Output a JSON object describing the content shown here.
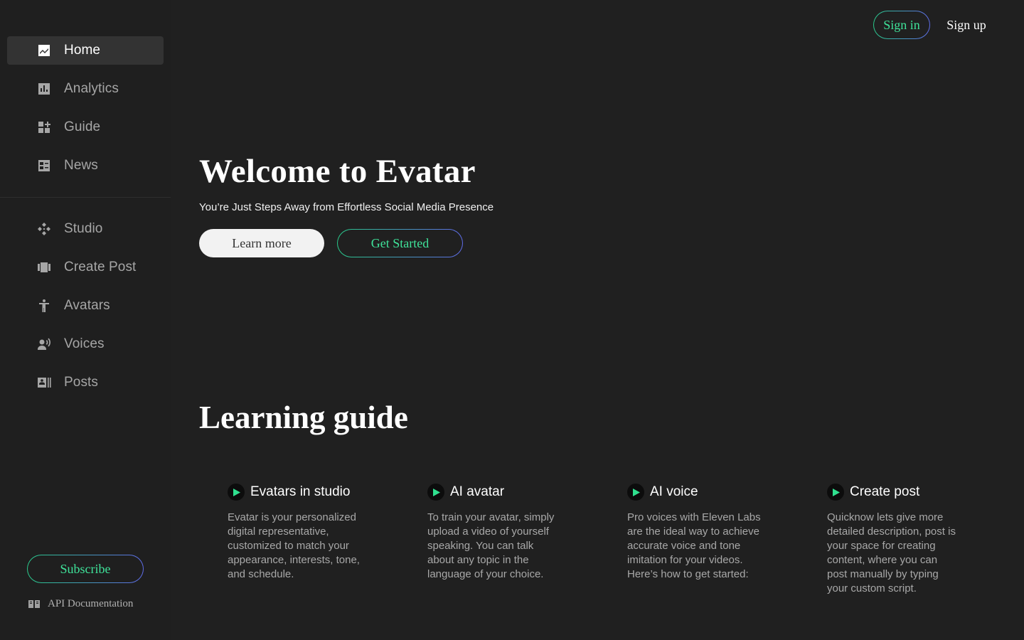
{
  "sidebar": {
    "items": [
      {
        "label": "Home",
        "icon": "home-chart-icon",
        "active": true
      },
      {
        "label": "Analytics",
        "icon": "bar-chart-icon"
      },
      {
        "label": "Guide",
        "icon": "grid-plus-icon"
      },
      {
        "label": "News",
        "icon": "news-icon"
      },
      {
        "label": "Studio",
        "icon": "studio-icon"
      },
      {
        "label": "Create Post",
        "icon": "carousel-icon"
      },
      {
        "label": "Avatars",
        "icon": "person-icon"
      },
      {
        "label": "Voices",
        "icon": "voice-icon"
      },
      {
        "label": "Posts",
        "icon": "posts-icon"
      }
    ],
    "subscribe_label": "Subscribe",
    "api_doc_label": "API Documentation"
  },
  "header": {
    "signin_label": "Sign in",
    "signup_label": "Sign up"
  },
  "hero": {
    "title": "Welcome to Evatar",
    "subtitle": "You’re Just Steps Away from Effortless Social Media Presence",
    "learn_label": "Learn more",
    "start_label": "Get Started"
  },
  "guide": {
    "title": "Learning guide",
    "cards": [
      {
        "title": "Evatars in studio",
        "desc": "Evatar is your personalized digital representative, customized to match your appearance, interests, tone, and schedule."
      },
      {
        "title": "AI avatar",
        "desc": "To train your avatar, simply upload a video of yourself speaking. You can talk about any topic in the language of your choice."
      },
      {
        "title": "AI voice",
        "desc": "Pro voices with Eleven Labs are the ideal way to achieve accurate voice and tone imitation for your videos. Here’s how to get started:"
      },
      {
        "title": "Create post",
        "desc": "Quicknow lets give more detailed description,  post is your space for creating content, where you can post manually by typing your custom script."
      }
    ]
  },
  "colors": {
    "background": "#202020",
    "accent_green": "#3fe39a",
    "accent_gradient_end": "#5f6be8",
    "active_item_bg": "#333333"
  }
}
